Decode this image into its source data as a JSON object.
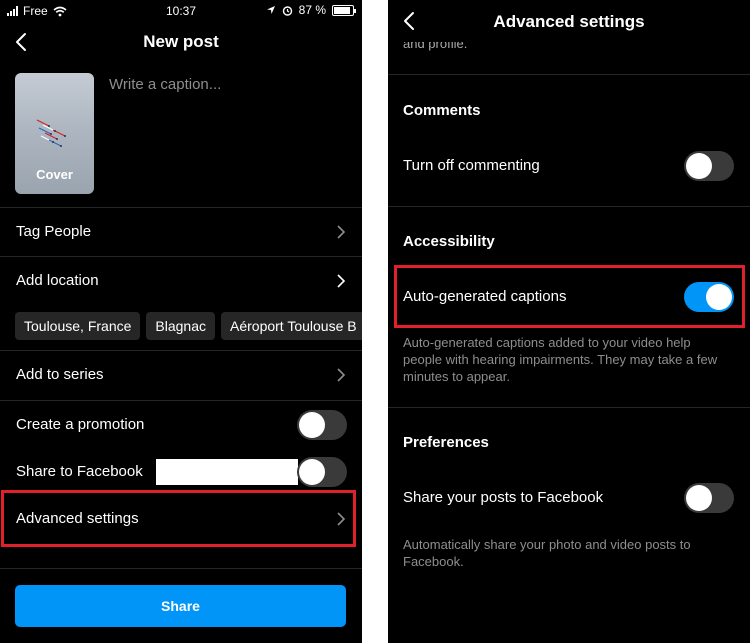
{
  "status_bar": {
    "carrier": "Free",
    "time": "10:37",
    "battery_text": "87 %",
    "battery_level": 0.87
  },
  "new_post": {
    "title": "New post",
    "cover_label": "Cover",
    "caption_placeholder": "Write a caption...",
    "tag_people": "Tag People",
    "add_location": "Add location",
    "location_chips": [
      "Toulouse, France",
      "Blagnac",
      "Aéroport Toulouse B"
    ],
    "add_to_series": "Add to series",
    "create_promotion": "Create a promotion",
    "create_promotion_on": false,
    "share_to_facebook": "Share to Facebook",
    "share_to_facebook_on": false,
    "advanced_settings": "Advanced settings",
    "share_button": "Share"
  },
  "advanced": {
    "title": "Advanced settings",
    "cut_text": "and profile.",
    "comments_title": "Comments",
    "turn_off_commenting": "Turn off commenting",
    "turn_off_commenting_on": false,
    "accessibility_title": "Accessibility",
    "auto_captions": "Auto-generated captions",
    "auto_captions_on": true,
    "auto_captions_help": "Auto-generated captions added to your video help people with hearing impairments. They may take a few minutes to appear.",
    "preferences_title": "Preferences",
    "share_posts_facebook": "Share your posts to Facebook",
    "share_posts_facebook_on": false,
    "share_posts_help": "Automatically share your photo and video posts to Facebook."
  },
  "colors": {
    "background": "#000000",
    "accent": "#0095f6",
    "highlight": "#e0202a",
    "secondary_text": "#8e8e8e"
  },
  "icons": [
    "signal-icon",
    "wifi-icon",
    "location-arrow-icon",
    "alarm-icon",
    "battery-icon",
    "back-chevron-icon",
    "chevron-right-icon"
  ]
}
